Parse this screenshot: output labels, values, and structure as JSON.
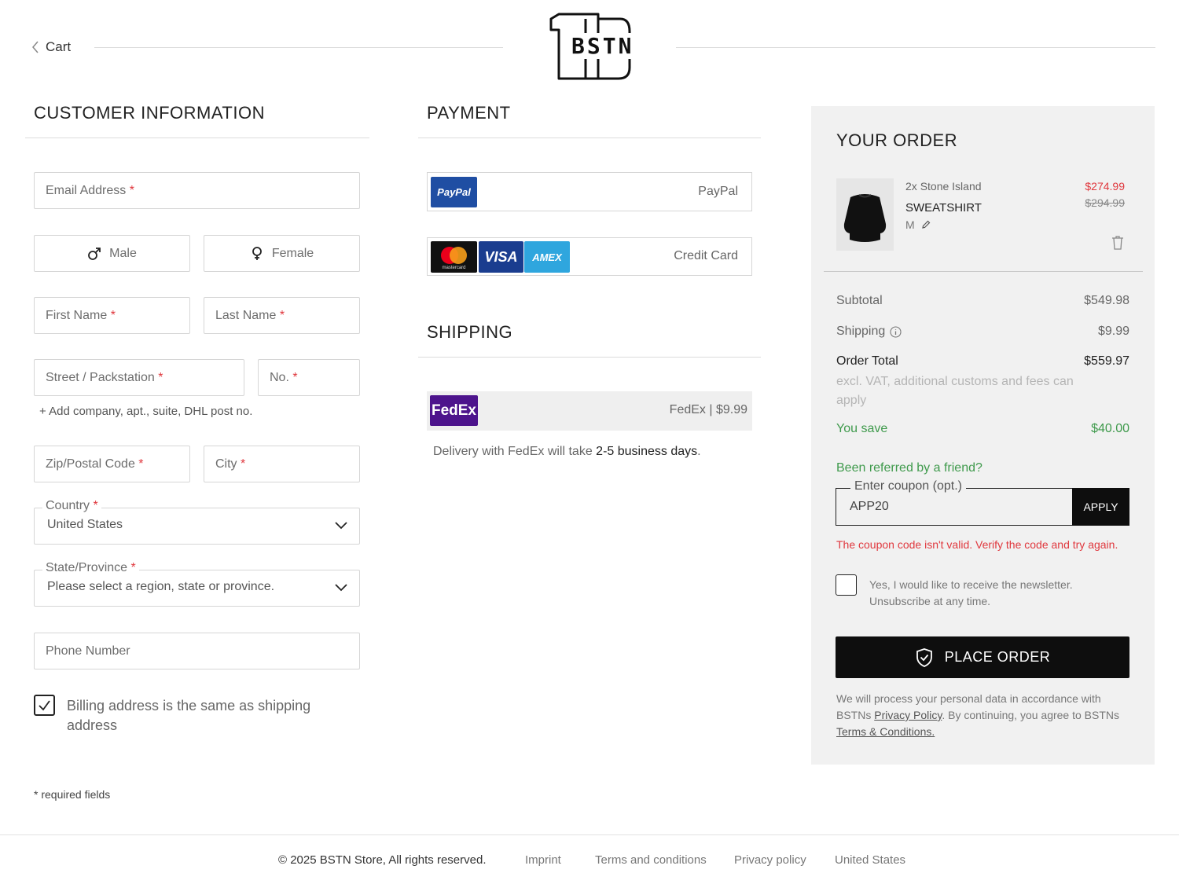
{
  "header": {
    "back_label": "Cart",
    "logo_text": "BSTN"
  },
  "customer": {
    "title": "CUSTOMER INFORMATION",
    "email_label": "Email Address",
    "required_mark": "*",
    "male_label": "Male",
    "female_label": "Female",
    "first_name_label": "First Name",
    "last_name_label": "Last Name",
    "street_label": "Street / Packstation",
    "number_label": "No.",
    "add_company_label": "+ Add company, apt., suite, DHL post no.",
    "zip_label": "Zip/Postal Code",
    "city_label": "City",
    "country_label": "Country",
    "country_value": "United States",
    "state_label": "State/Province",
    "state_value": "Please select a region, state or province.",
    "phone_label": "Phone Number",
    "billing_same_label": "Billing address is the same as shipping address",
    "billing_same_checked": true,
    "required_note": "* required fields"
  },
  "payment": {
    "title": "PAYMENT",
    "paypal_logo": "PayPal",
    "paypal_label": "PayPal",
    "credit_card_label": "Credit Card",
    "visa_logo": "VISA",
    "amex_logo": "AMEX",
    "mastercard_logo": "mastercard"
  },
  "shipping": {
    "title": "SHIPPING",
    "carrier_logo": "FedEx",
    "carrier_label": "FedEx | $9.99",
    "delivery_prefix": "Delivery with FedEx will take ",
    "delivery_days": "2-5 business days",
    "delivery_suffix": "."
  },
  "order": {
    "title": "YOUR ORDER",
    "item": {
      "quantity": "2x",
      "brand": "Stone Island",
      "name": "SWEATSHIRT",
      "size": "M",
      "price": "$274.99",
      "old_price": "$294.99"
    },
    "subtotal_label": "Subtotal",
    "subtotal_value": "$549.98",
    "shipping_label": "Shipping",
    "shipping_value": "$9.99",
    "total_label": "Order Total",
    "total_value": "$559.97",
    "total_note": "excl. VAT, additional customs and fees can apply",
    "save_label": "You save",
    "save_value": "$40.00",
    "referral_label": "Been referred by a friend?",
    "coupon_label": "Enter coupon (opt.)",
    "coupon_value": "APP20",
    "apply_label": "APPLY",
    "coupon_error": "The coupon code isn't valid. Verify the code and try again.",
    "newsletter_label": "Yes, I would like to receive the newsletter. Unsubscribe at any time.",
    "place_order_label": "PLACE ORDER",
    "legal_prefix": "We will process your personal data in accordance with BSTNs ",
    "privacy_link": "Privacy Policy",
    "legal_middle": ". By continuing, you agree to BSTNs ",
    "terms_link": "Terms & Conditions."
  },
  "footer": {
    "copyright": "© 2025 BSTN Store, All rights reserved.",
    "imprint": "Imprint",
    "terms": "Terms and conditions",
    "privacy": "Privacy policy",
    "region": "United States"
  },
  "colors": {
    "accent_green": "#3f9a4c",
    "error_red": "#e0383e",
    "primary_black": "#0e0e0e",
    "panel_gray": "#f1f1f1"
  }
}
